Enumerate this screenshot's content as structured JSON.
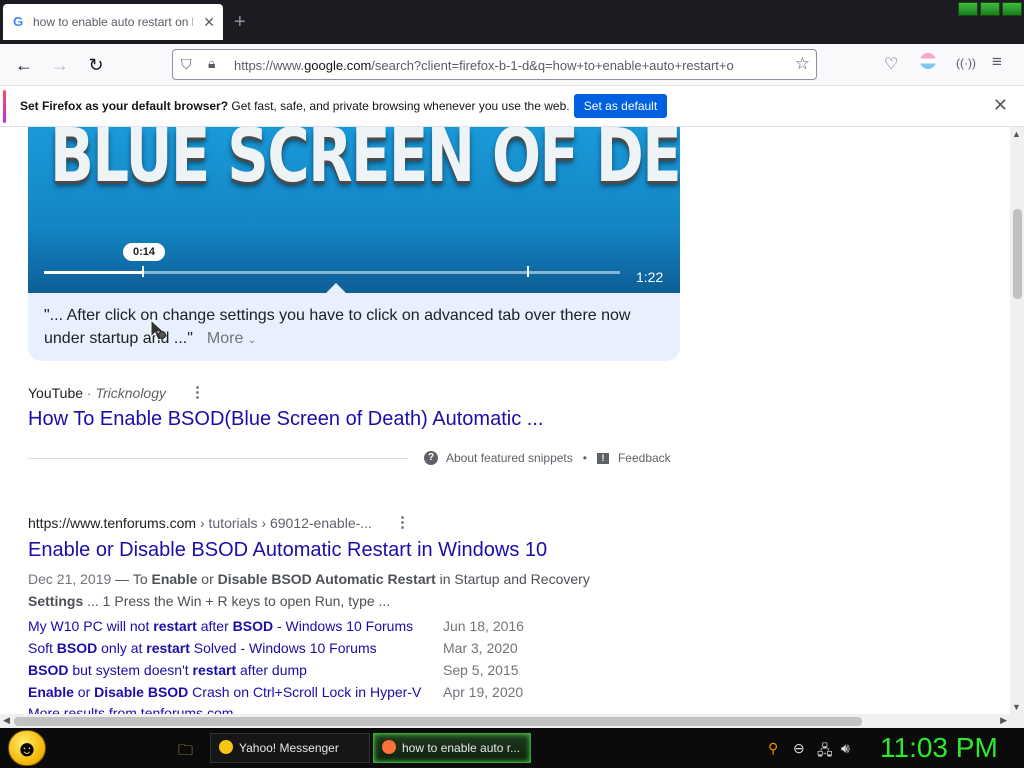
{
  "browser": {
    "tab_title": "how to enable auto restart on b",
    "tab_favicon": "G",
    "new_tab_glyph": "+",
    "url_prefix": "https://www.",
    "url_domain": "google.com",
    "url_rest": "/search?client=firefox-b-1-d&q=how+to+enable+auto+restart+o",
    "icons": {
      "back": "back-arrow-icon",
      "forward": "forward-arrow-icon",
      "reload": "reload-icon",
      "shield": "tracking-shield-icon",
      "lock": "lock-icon",
      "star": "bookmark-star-icon",
      "pocket": "pocket-icon",
      "account": "account-icon",
      "extension": "extension-icon",
      "menu": "hamburger-menu-icon"
    }
  },
  "notification": {
    "bold": "Set Firefox as your default browser?",
    "text": " Get fast, safe, and private browsing whenever you use the web.",
    "button": "Set as default"
  },
  "video": {
    "overlay_text": "BLUE SCREEN OF DEATH",
    "current_time": "0:14",
    "duration": "1:22",
    "progress_fraction": 0.172,
    "chapter_mark_fraction": 0.84
  },
  "snippet": {
    "quote": "\"... After click on change settings you have to click on advanced tab over there now under startup and ...\"",
    "more": "More"
  },
  "result1": {
    "source": "YouTube",
    "separator": " · ",
    "channel": "Tricknology",
    "title": "How To Enable BSOD(Blue Screen of Death) Automatic ..."
  },
  "featured": {
    "about": "About featured snippets",
    "dot": "•",
    "feedback": "Feedback"
  },
  "result2": {
    "cite_host": "https://www.tenforums.com",
    "cite_path": " › tutorials › 69012-enable-...",
    "title": "Enable or Disable BSOD Automatic Restart in Windows 10",
    "date": "Dec 21, 2019",
    "sublinks": [
      {
        "text": "My W10 PC will not restart after BSOD - Windows 10 Forums",
        "date": "Jun 18, 2016"
      },
      {
        "text": "Soft BSOD only at restart Solved - Windows 10 Forums",
        "date": "Mar 3, 2020"
      },
      {
        "text": "BSOD but system doesn't restart after dump",
        "date": "Sep 5, 2015"
      },
      {
        "text": "Enable or Disable BSOD Crash on Ctrl+Scroll Lock in Hyper-V",
        "date": "Apr 19, 2020"
      }
    ],
    "cutoff_text": "More results from tenforums.com"
  },
  "taskbar": {
    "tasks": [
      {
        "label": "Yahoo! Messenger",
        "color": "#f5c518"
      },
      {
        "label": "how to enable auto r...",
        "color": "#ff7139"
      }
    ],
    "clock": "11:03 PM"
  },
  "colors": {
    "link": "#1a0dab",
    "notify_button": "#0061e0",
    "clock": "#2ee82e"
  }
}
